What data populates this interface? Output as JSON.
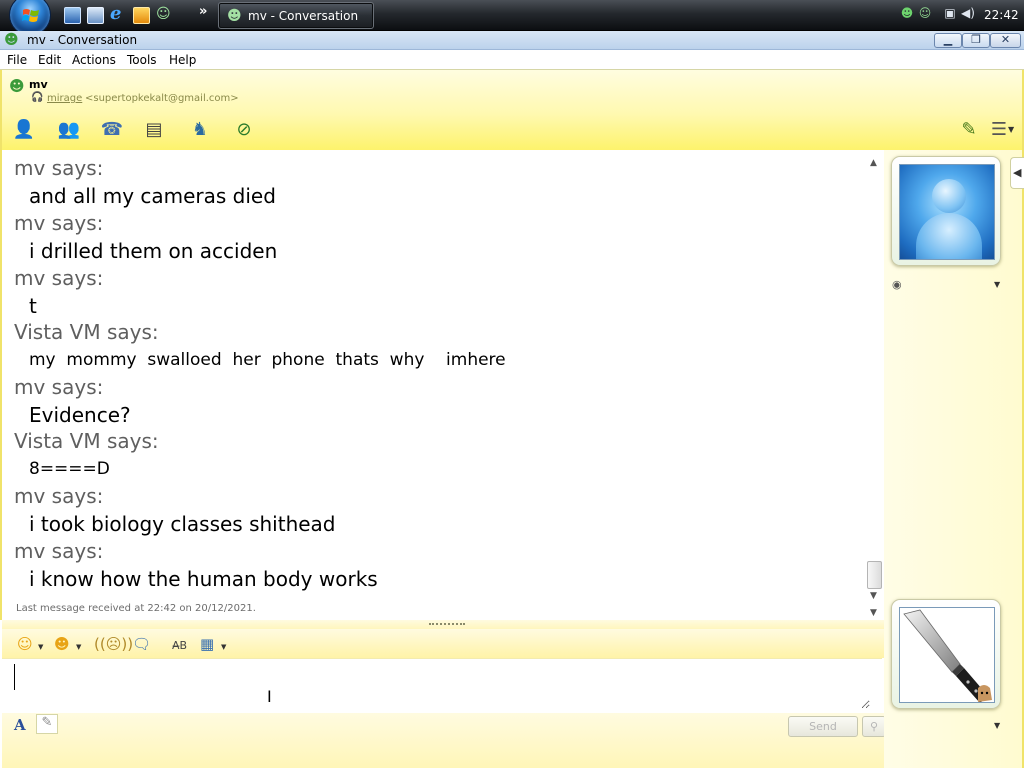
{
  "taskbar": {
    "quick_launch": [
      "show-desktop-icon",
      "switch-windows-icon",
      "internet-explorer-icon",
      "media-player-icon",
      "messenger-icon"
    ],
    "more_label": "»",
    "task_button_label": "mv - Conversation",
    "tray_icons": [
      "messenger-status-icon",
      "network-icon",
      "volume-icon"
    ],
    "clock": "22:42"
  },
  "window": {
    "title": "mv - Conversation",
    "controls": [
      "minimize",
      "maximize",
      "close"
    ]
  },
  "menu": [
    "File",
    "Edit",
    "Actions",
    "Tools",
    "Help"
  ],
  "contact": {
    "name": "mv",
    "nickname": "mirage",
    "email": "<supertopkekalt@gmail.com>"
  },
  "toolbar": {
    "left": [
      "invite-contact-icon",
      "share-files-icon",
      "call-icon",
      "video-icon",
      "games-icon",
      "block-contact-icon"
    ],
    "right": [
      "theme-brush-icon",
      "show-menu-icon"
    ]
  },
  "conversation": {
    "messages": [
      {
        "sender": "mv says:",
        "text": "and all my cameras died"
      },
      {
        "sender": "mv says:",
        "text": "i drilled them on acciden"
      },
      {
        "sender": "mv says:",
        "text": "t"
      },
      {
        "sender": "Vista VM says:",
        "text": "my  mommy  swalloed  her  phone  thats  why    imhere"
      },
      {
        "sender": "mv says:",
        "text": "Evidence?"
      },
      {
        "sender": "Vista VM says:",
        "text": "8====D"
      },
      {
        "sender": "mv says:",
        "text": "i took biology classes shithead"
      },
      {
        "sender": "mv says:",
        "text": "i know how the human body works"
      }
    ],
    "last_received": "Last message received at 22:42 on 20/12/2021."
  },
  "compose_toolbar": [
    "emoticon-icon",
    "wink-icon",
    "nudge-icon",
    "voice-clip-icon",
    "font-style-icon",
    "background-icon"
  ],
  "compose": {
    "value": "",
    "font_button": "A",
    "send_label": "Send",
    "search_label": "🔍"
  },
  "colors": {
    "header_gradient_top": "#fffde0",
    "header_gradient_bottom": "#fdf36c",
    "sender_text": "#5f5f5f",
    "taskbar": "#1b1e22"
  }
}
